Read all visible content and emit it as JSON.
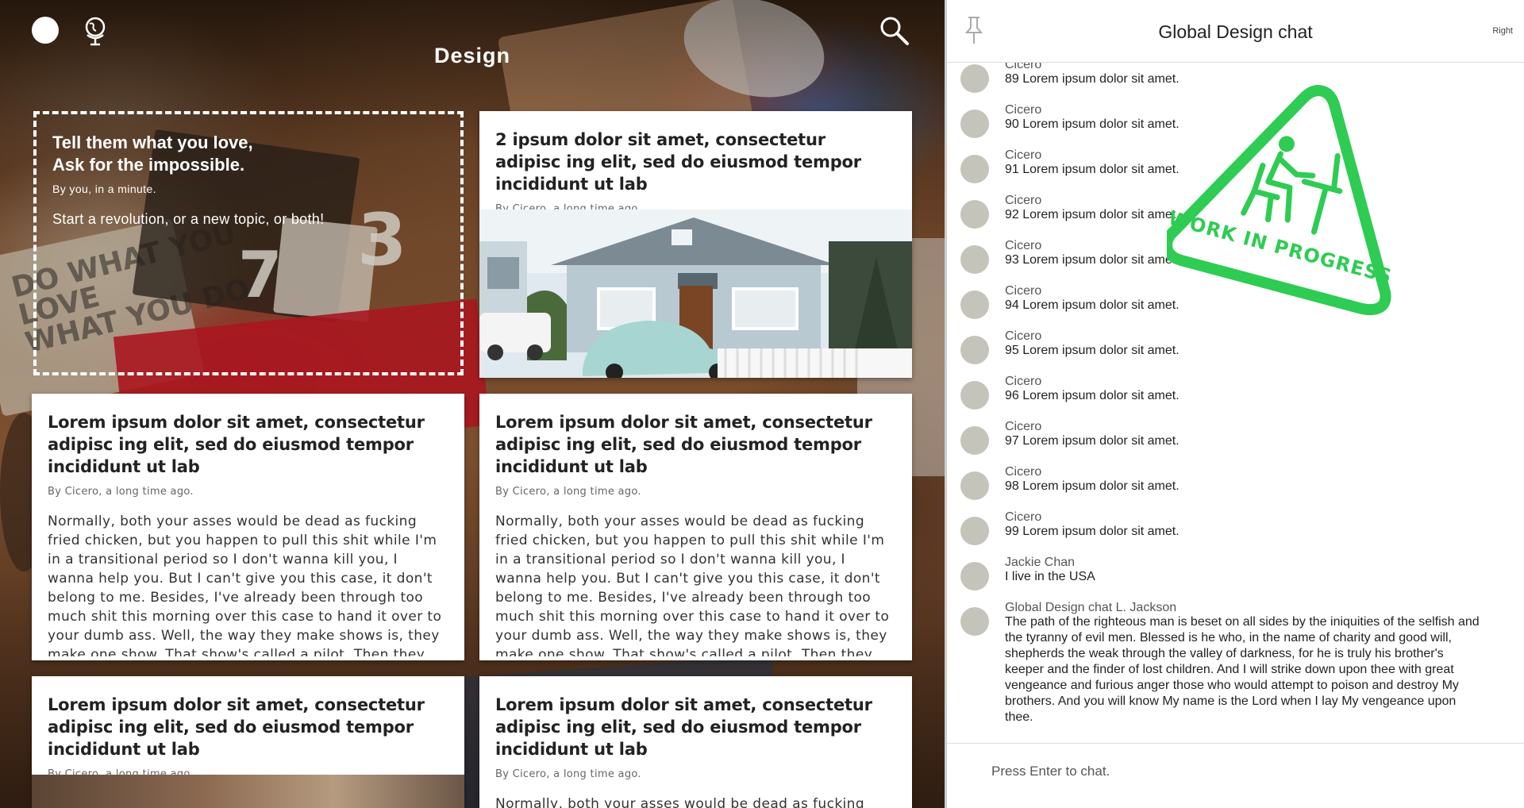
{
  "header": {
    "title": "Design"
  },
  "new_topic": {
    "line1": "Tell them what you love,",
    "line2": "Ask for the impossible.",
    "byline": "By you, in a minute.",
    "cta": "Start a revolution, or a new topic, or both!"
  },
  "cards": [
    {
      "title": "2 ipsum dolor sit amet, consectetur adipisc ing elit, sed do eiusmod tempor incididunt ut lab",
      "byline": "By Cicero, a long time ago."
    },
    {
      "title": "Lorem ipsum dolor sit amet, consectetur adipisc ing elit, sed do eiusmod tempor incididunt ut lab",
      "byline": "By Cicero, a long time ago.",
      "body": "Normally, both your asses would be dead as fucking fried chicken, but you happen to pull this shit while I'm in a transitional period so I don't wanna kill you, I wanna help you. But I can't give you this case, it don't belong to me. Besides, I've already been through too much shit this morning over this case to hand it over to your dumb ass. Well, the way they make shows is, they make one show. That show's called a pilot. Then they"
    },
    {
      "title": "Lorem ipsum dolor sit amet, consectetur adipisc ing elit, sed do eiusmod tempor incididunt ut lab",
      "byline": "By Cicero, a long time ago.",
      "body": "Normally, both your asses would be dead as fucking fried chicken, but you happen to pull this shit while I'm in a transitional period so I don't wanna kill you, I wanna help you. But I can't give you this case, it don't belong to me. Besides, I've already been through too much shit this morning over this case to hand it over to your dumb ass. Well, the way they make shows is, they make one show. That show's called a pilot. Then they"
    },
    {
      "title": "Lorem ipsum dolor sit amet, consectetur adipisc ing elit, sed do eiusmod tempor incididunt ut lab",
      "byline": "By Cicero, a long time ago."
    },
    {
      "title": "Lorem ipsum dolor sit amet, consectetur adipisc ing elit, sed do eiusmod tempor incididunt ut lab",
      "byline": "By Cicero, a long time ago.",
      "body": "Normally, both your asses would be dead as fucking fried chicken, but you happen to pull this shit while I'm"
    }
  ],
  "chat": {
    "title": "Global Design chat",
    "right_label": "Right",
    "input_placeholder": "Press Enter to chat.",
    "messages": [
      {
        "name": "Cicero",
        "text": "89 Lorem ipsum dolor sit amet."
      },
      {
        "name": "Cicero",
        "text": "90 Lorem ipsum dolor sit amet."
      },
      {
        "name": "Cicero",
        "text": "91 Lorem ipsum dolor sit amet."
      },
      {
        "name": "Cicero",
        "text": "92 Lorem ipsum dolor sit amet."
      },
      {
        "name": "Cicero",
        "text": "93 Lorem ipsum dolor sit amet."
      },
      {
        "name": "Cicero",
        "text": "94 Lorem ipsum dolor sit amet."
      },
      {
        "name": "Cicero",
        "text": "95 Lorem ipsum dolor sit amet."
      },
      {
        "name": "Cicero",
        "text": "96 Lorem ipsum dolor sit amet."
      },
      {
        "name": "Cicero",
        "text": "97 Lorem ipsum dolor sit amet."
      },
      {
        "name": "Cicero",
        "text": "98 Lorem ipsum dolor sit amet."
      },
      {
        "name": "Cicero",
        "text": "99 Lorem ipsum dolor sit amet."
      },
      {
        "name": "Jackie Chan",
        "text": "I live in the USA"
      },
      {
        "name": "Global Design chat L. Jackson",
        "text": "The path of the righteous man is beset on all sides by the iniquities of the selfish and the tyranny of evil men. Blessed is he who, in the name of charity and good will, shepherds the weak through the valley of darkness, for he is truly his brother's keeper and the finder of lost children. And I will strike down upon thee with great vengeance and furious anger those who would attempt to poison and destroy My brothers. And you will know My name is the Lord when I lay My vengeance upon thee."
      }
    ]
  },
  "stamp": {
    "text": "WORK IN PROGRESS",
    "color": "#2ecc52"
  },
  "icons": {
    "avatar": "avatar-circle",
    "globe": "globe-icon",
    "search": "search-icon",
    "pin": "pin-icon"
  }
}
